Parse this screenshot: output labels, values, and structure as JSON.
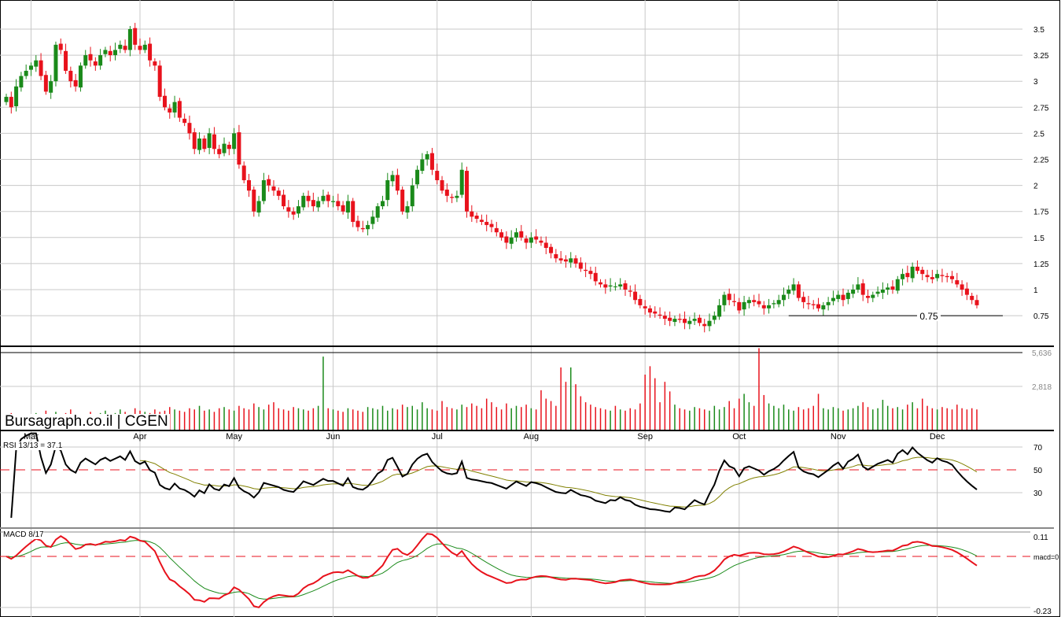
{
  "watermark": "Bursagraph.co.il | CGEN",
  "colors": {
    "up": "#1a8a1a",
    "down": "#e8121c",
    "grid": "#c8c8c8",
    "signal_rsi": "#808000",
    "signal_macd": "#1a8a1a",
    "macd": "#e8121c"
  },
  "chart_data": [
    {
      "type": "candlestick",
      "title": "CGEN",
      "months": [
        "Mar",
        "Apr",
        "May",
        "Jun",
        "Jul",
        "Aug",
        "Sep",
        "Oct",
        "Nov",
        "Dec"
      ],
      "month_start_index": [
        5,
        27,
        46,
        66,
        87,
        106,
        129,
        148,
        168,
        188
      ],
      "y_ticks": [
        "3.5",
        "3.25",
        "3",
        "2.75",
        "2.5",
        "2.25",
        "2",
        "1.75",
        "1.5",
        "1.25",
        "1",
        "0.75"
      ],
      "ylim": [
        0.6,
        3.6
      ],
      "support_line": {
        "value": 0.75,
        "label": "0.75"
      },
      "closes": [
        2.85,
        2.75,
        2.95,
        3.05,
        3.1,
        3.15,
        3.2,
        3.05,
        2.9,
        3.0,
        3.35,
        3.3,
        3.1,
        3.0,
        2.95,
        3.15,
        3.25,
        3.2,
        3.15,
        3.25,
        3.3,
        3.25,
        3.3,
        3.35,
        3.3,
        3.5,
        3.35,
        3.3,
        3.35,
        3.2,
        3.15,
        2.85,
        2.75,
        2.7,
        2.8,
        2.65,
        2.6,
        2.5,
        2.35,
        2.45,
        2.35,
        2.5,
        2.35,
        2.3,
        2.4,
        2.35,
        2.5,
        2.2,
        2.05,
        1.95,
        1.75,
        1.85,
        2.05,
        2.0,
        1.95,
        1.9,
        1.8,
        1.75,
        1.72,
        1.8,
        1.9,
        1.85,
        1.8,
        1.85,
        1.9,
        1.85,
        1.85,
        1.8,
        1.75,
        1.85,
        1.65,
        1.6,
        1.58,
        1.62,
        1.7,
        1.8,
        1.85,
        2.05,
        2.1,
        1.95,
        1.75,
        1.8,
        2.0,
        2.15,
        2.25,
        2.3,
        2.15,
        2.05,
        1.95,
        1.9,
        1.88,
        1.9,
        2.15,
        1.75,
        1.7,
        1.68,
        1.65,
        1.62,
        1.6,
        1.55,
        1.5,
        1.45,
        1.5,
        1.55,
        1.5,
        1.45,
        1.5,
        1.48,
        1.45,
        1.4,
        1.35,
        1.3,
        1.28,
        1.27,
        1.3,
        1.25,
        1.2,
        1.18,
        1.15,
        1.08,
        1.05,
        1.02,
        1.04,
        1.03,
        1.05,
        1.0,
        0.98,
        0.9,
        0.85,
        0.82,
        0.78,
        0.77,
        0.75,
        0.72,
        0.7,
        0.72,
        0.71,
        0.68,
        0.7,
        0.72,
        0.68,
        0.65,
        0.7,
        0.75,
        0.85,
        0.95,
        0.9,
        0.88,
        0.8,
        0.88,
        0.9,
        0.88,
        0.86,
        0.82,
        0.85,
        0.87,
        0.9,
        0.95,
        1.0,
        1.05,
        0.92,
        0.88,
        0.86,
        0.85,
        0.82,
        0.85,
        0.88,
        0.92,
        0.95,
        0.9,
        0.97,
        1.0,
        1.05,
        0.95,
        0.92,
        0.95,
        0.98,
        1.0,
        1.02,
        1.0,
        1.1,
        1.15,
        1.12,
        1.22,
        1.18,
        1.15,
        1.12,
        1.1,
        1.15,
        1.13,
        1.12,
        1.1,
        1.05,
        1.0,
        0.95,
        0.9,
        0.85
      ]
    },
    {
      "type": "bar",
      "title": "Volume",
      "y_ticks": [
        "5,636",
        "2,818"
      ],
      "ylim": [
        0,
        6000
      ],
      "values": [
        300,
        600,
        400,
        300,
        500,
        400,
        600,
        300,
        800,
        500,
        700,
        400,
        600,
        900,
        300,
        500,
        400,
        700,
        500,
        600,
        800,
        500,
        600,
        900,
        700,
        500,
        1000,
        800,
        700,
        600,
        900,
        700,
        800,
        1100,
        900,
        800,
        700,
        1000,
        900,
        1200,
        800,
        900,
        700,
        1000,
        1100,
        900,
        800,
        1200,
        1000,
        900,
        1400,
        1100,
        900,
        1300,
        1500,
        1000,
        900,
        800,
        1100,
        1000,
        900,
        800,
        1000,
        1200,
        5300,
        1000,
        900,
        800,
        700,
        1000,
        900,
        800,
        700,
        1100,
        1000,
        900,
        1200,
        800,
        1000,
        900,
        1300,
        1100,
        1200,
        900,
        1500,
        1000,
        900,
        800,
        1600,
        1100,
        1000,
        900,
        1300,
        1100,
        1400,
        1200,
        1000,
        1800,
        1500,
        1100,
        900,
        1400,
        1000,
        1200,
        1100,
        1300,
        1000,
        900,
        2500,
        1800,
        1600,
        1200,
        4400,
        3200,
        4400,
        3000,
        2000,
        1500,
        1300,
        1100,
        1000,
        900,
        800,
        1200,
        900,
        800,
        1000,
        900,
        1400,
        3800,
        4500,
        3500,
        1500,
        3200,
        2400,
        1300,
        1000,
        900,
        800,
        1100,
        1000,
        900,
        800,
        1200,
        900,
        1100,
        1600,
        1000,
        1800,
        2200,
        1500,
        1200,
        6000,
        2100,
        1400,
        1200,
        1000,
        1300,
        900,
        800,
        1100,
        900,
        1000,
        1200,
        2200,
        1000,
        900,
        1100,
        1000,
        800,
        900,
        1000,
        1200,
        1500,
        1100,
        900,
        1000,
        1700,
        1200,
        1000,
        1100,
        900,
        1300,
        1500,
        1000,
        1800,
        1200,
        1000,
        900,
        1100,
        1000,
        900,
        1300,
        1000,
        900,
        1000,
        900
      ]
    },
    {
      "type": "line",
      "title": "RSI 13/13 = 37.1",
      "y_ticks": [
        "70",
        "50",
        "30"
      ],
      "ylim": [
        0,
        85
      ],
      "reference": 50
    },
    {
      "type": "line",
      "title": "MACD 8/17",
      "y_ticks": [
        "0.11",
        "macd=0",
        "-0.23"
      ],
      "ylim": [
        -0.23,
        0.11
      ],
      "reference": 0
    }
  ]
}
